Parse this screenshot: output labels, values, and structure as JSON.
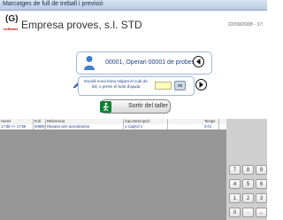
{
  "window": {
    "title": "Marcatges de full de treball i previsió"
  },
  "header": {
    "logo_text": "(G)",
    "logo_subtext": "software",
    "company": "Empresa proves, s.l. STD",
    "datetime": "22/09/2008 - 17:"
  },
  "operator": {
    "label": "00001, Operari 00001 de probes"
  },
  "instructions": {
    "text": "Escolli nova feina mitjant el codi de full, o premi el botó d'ajuda",
    "code_value": "",
    "ok_label": "ok"
  },
  "exit": {
    "label": "Sortir del taller"
  },
  "table": {
    "columns": [
      "Hores",
      "Full",
      "Referencia",
      "Cap.Descripció",
      "Temps"
    ],
    "rows": [
      [
        "17:56 >> 17:58",
        "00806",
        "Reparar aire acondicionat",
        "1 Capítol 1",
        "0:01"
      ]
    ]
  },
  "keypad": {
    "keys": [
      "7",
      "8",
      "9",
      "4",
      "5",
      "6",
      "1",
      "2",
      "3",
      "0",
      "·",
      "←"
    ]
  },
  "colors": {
    "accent_blue": "#1f3e8a",
    "panel_border": "#9fb7d6",
    "table_background": "#969696",
    "exit_icon_green": "#0a7f2e"
  },
  "icons": [
    "person-icon",
    "left-arrow-circle-icon",
    "right-arrow-circle-icon",
    "pencil-icon",
    "exit-door-icon"
  ]
}
